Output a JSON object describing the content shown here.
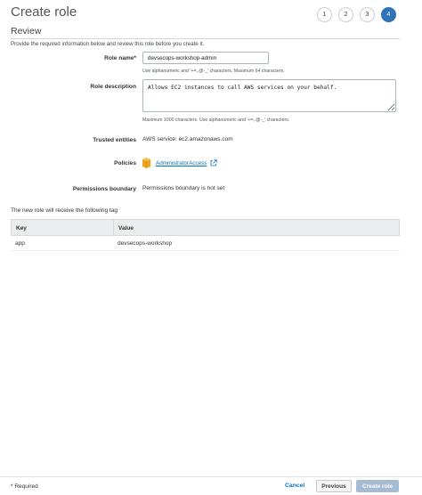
{
  "page": {
    "title": "Create role"
  },
  "steps": [
    "1",
    "2",
    "3",
    "4"
  ],
  "active_step": "4",
  "review": {
    "heading": "Review",
    "intro": "Provide the required information below and review this role before you create it."
  },
  "role_name": {
    "label": "Role name*",
    "value": "devsecops-workshop-admin",
    "hint": "Use alphanumeric and '+=,.@-_' characters. Maximum 64 characters."
  },
  "role_description": {
    "label": "Role description",
    "value": "Allows EC2 instances to call AWS services on your behalf.",
    "hint": "Maximum 1000 characters. Use alphanumeric and '+=,.@-_' characters."
  },
  "trusted_entities": {
    "label": "Trusted entities",
    "value": "AWS service: ec2.amazonaws.com"
  },
  "policies": {
    "label": "Policies",
    "link": "AdministratorAccess"
  },
  "permissions_boundary": {
    "label": "Permissions boundary",
    "value": "Permissions boundary is not set"
  },
  "tags": {
    "caption": "The new role will receive the following tag",
    "columns": {
      "key": "Key",
      "value": "Value"
    },
    "rows": [
      {
        "key": "app",
        "value": "devsecops-workshop"
      }
    ]
  },
  "footer": {
    "required_note": "* Required",
    "cancel": "Cancel",
    "previous": "Previous",
    "create": "Create role"
  },
  "colors": {
    "accent": "#2e73b8",
    "link": "#0073bb",
    "policy_icon": "#f0a41c",
    "disabled_button": "#a7bad3"
  }
}
